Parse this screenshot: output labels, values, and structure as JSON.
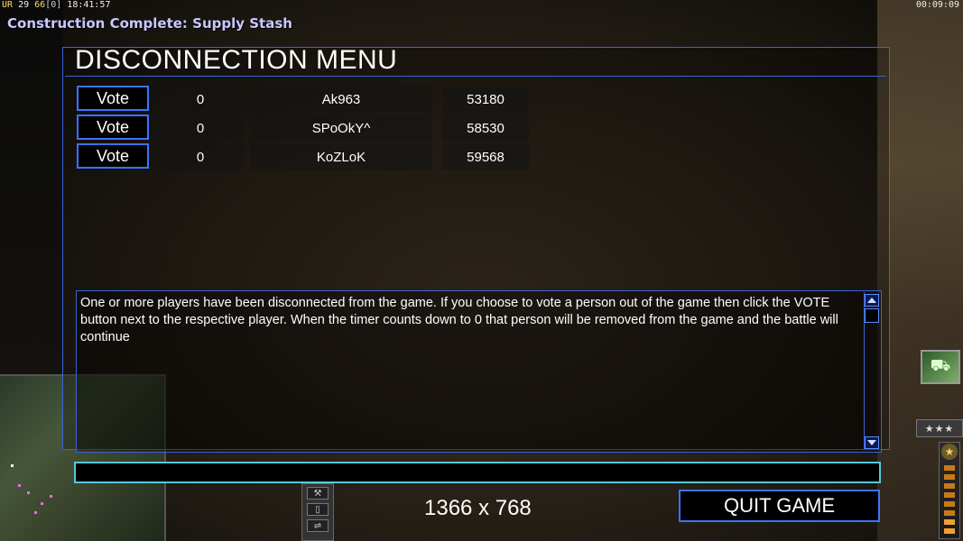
{
  "hud": {
    "ur_label": "UR",
    "ur_value": "29",
    "fps": "66",
    "bracket": "[0]",
    "time": "18:41:57",
    "game_clock": "00:09:09"
  },
  "notification": "Construction Complete: Supply Stash",
  "dialog": {
    "title": "DISCONNECTION MENU",
    "players": [
      {
        "vote_label": "Vote",
        "count": "0",
        "name": "Ak963",
        "ping": "53180"
      },
      {
        "vote_label": "Vote",
        "count": "0",
        "name": "SPoOkY^",
        "ping": "58530"
      },
      {
        "vote_label": "Vote",
        "count": "0",
        "name": "KoZLoK",
        "ping": "59568"
      }
    ],
    "message": "One or more players have been disconnected from the game. If you choose to vote a person out of the game then click the VOTE button next to the respective player. When the timer counts down to 0 that person will be removed from the game and the battle will continue",
    "chat_value": "",
    "resolution": "1366 x 768",
    "quit_label": "QUIT GAME"
  },
  "colors": {
    "panel_border": "#3a64d8",
    "button_border": "#3a74ff",
    "chat_border": "#58c8d8",
    "notice_text": "#c8c8ff"
  },
  "icons": {
    "scroll_up": "triangle-up-icon",
    "scroll_down": "triangle-down-icon",
    "rank": "star-icon",
    "unit_portrait": "vehicle-icon"
  }
}
